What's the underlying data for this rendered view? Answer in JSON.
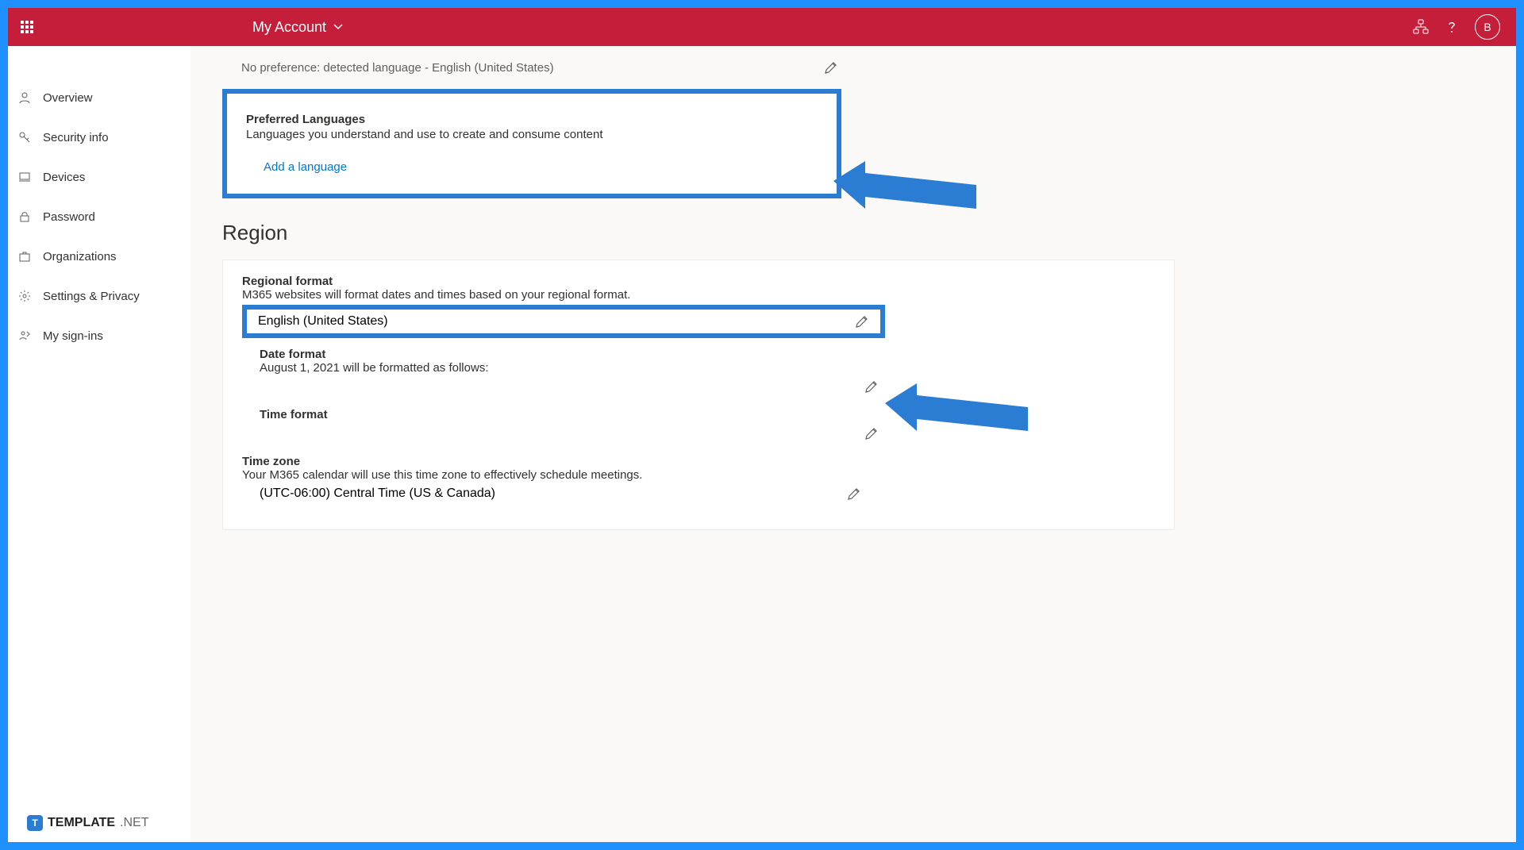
{
  "header": {
    "title": "My Account",
    "avatar_initial": "B"
  },
  "sidebar": {
    "items": [
      {
        "label": "Overview",
        "icon": "person"
      },
      {
        "label": "Security info",
        "icon": "key"
      },
      {
        "label": "Devices",
        "icon": "laptop"
      },
      {
        "label": "Password",
        "icon": "lock"
      },
      {
        "label": "Organizations",
        "icon": "briefcase"
      },
      {
        "label": "Settings & Privacy",
        "icon": "gear"
      },
      {
        "label": "My sign-ins",
        "icon": "signin"
      }
    ]
  },
  "display_language": {
    "no_preference_text": "No preference: detected language - English (United States)"
  },
  "preferred_languages": {
    "title": "Preferred Languages",
    "description": "Languages you understand and use to create and consume content",
    "add_link": "Add a language"
  },
  "region": {
    "header": "Region",
    "regional_format": {
      "title": "Regional format",
      "description": "M365 websites will format dates and times based on your regional format.",
      "value": "English (United States)"
    },
    "date_format": {
      "title": "Date format",
      "description": "August 1, 2021 will be formatted as follows:"
    },
    "time_format": {
      "title": "Time format"
    },
    "time_zone": {
      "title": "Time zone",
      "description": "Your M365 calendar will use this time zone to effectively schedule meetings.",
      "value": "(UTC-06:00) Central Time (US & Canada)"
    }
  },
  "watermark": {
    "brand_bold": "TEMPLATE",
    "brand_thin": ".NET"
  },
  "colors": {
    "header_bg": "#c41e3a",
    "annotation_blue": "#2b7cd3",
    "link_blue": "#0078d4",
    "frame_blue": "#1e90ff"
  }
}
